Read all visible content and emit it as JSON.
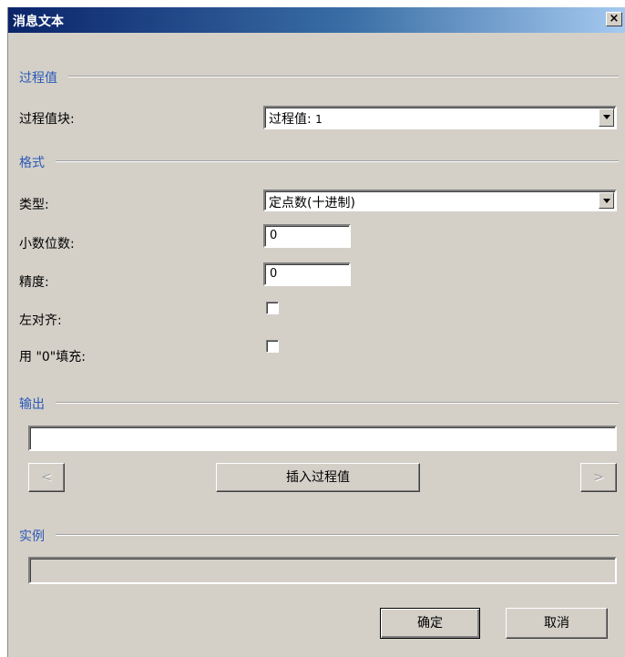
{
  "window": {
    "title": "消息文本",
    "close_glyph": "×"
  },
  "sections": {
    "process_value": "过程值",
    "format": "格式",
    "output": "输出",
    "example": "实例"
  },
  "process_value": {
    "block_label": "过程值块:",
    "block_selected_text": "过程值:",
    "block_selected_num": "1"
  },
  "format": {
    "type_label": "类型:",
    "type_selected": "定点数(十进制)",
    "decimals_label": "小数位数:",
    "decimals_value": "0",
    "precision_label": "精度:",
    "precision_value": "0",
    "left_align_label": "左对齐:",
    "left_align_checked": false,
    "zero_fill_label": "用 \"0\"填充:",
    "zero_fill_checked": false
  },
  "output": {
    "text_value": "",
    "prev_label": "<",
    "insert_label": "插入过程值",
    "next_label": ">"
  },
  "example": {
    "text_value": ""
  },
  "buttons": {
    "ok": "确定",
    "cancel": "取消"
  }
}
